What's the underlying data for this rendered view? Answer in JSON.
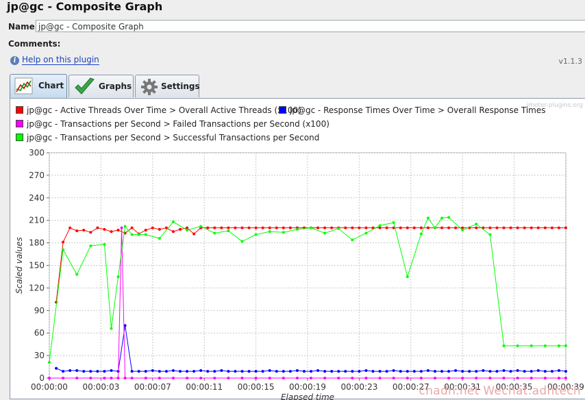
{
  "window": {
    "title": "jp@gc - Composite Graph"
  },
  "form": {
    "name_label": "Name:",
    "name_value": "jp@gc - Composite Graph",
    "comments_label": "Comments:",
    "help_link": "Help on this plugin",
    "version": "v1.1.3"
  },
  "tabs": [
    {
      "label": "Chart",
      "icon": "chart-icon",
      "active": true
    },
    {
      "label": "Graphs",
      "icon": "checkmark-icon",
      "active": false
    },
    {
      "label": "Settings",
      "icon": "gear-icon",
      "active": false
    }
  ],
  "watermark": "jmeter-plugins.org",
  "credit": "cnadn.net Wechat:adntech",
  "chart_data": {
    "type": "line",
    "xlabel": "Elapsed time",
    "ylabel": "Scaled values",
    "ylim": [
      0,
      300
    ],
    "yticks": [
      "0",
      "30",
      "60",
      "90",
      "120",
      "150",
      "180",
      "210",
      "240",
      "270",
      "300"
    ],
    "xticks": [
      {
        "t": 0,
        "label": "00:00:00"
      },
      {
        "t": 3.75,
        "label": "00:00:03"
      },
      {
        "t": 7.5,
        "label": "00:00:07"
      },
      {
        "t": 11.25,
        "label": "00:00:11"
      },
      {
        "t": 15,
        "label": "00:00:15"
      },
      {
        "t": 18.75,
        "label": "00:00:19"
      },
      {
        "t": 22.5,
        "label": "00:00:23"
      },
      {
        "t": 26.25,
        "label": "00:00:27"
      },
      {
        "t": 30,
        "label": "00:00:31"
      },
      {
        "t": 33.75,
        "label": "00:00:35"
      },
      {
        "t": 37.5,
        "label": "00:00:39"
      }
    ],
    "xmax": 37.5,
    "grid": true,
    "legend_position": "top",
    "series": [
      {
        "name": "jp@gc - Active Threads Over Time > Overall Active Threads (x100)",
        "color": "#ff0000",
        "legend_row": 0,
        "legend_col": 0,
        "x": [
          0.5,
          1,
          1.5,
          2,
          2.5,
          3,
          3.5,
          4,
          4.5,
          5,
          5.5,
          6,
          6.5,
          7,
          7.5,
          8,
          8.5,
          9,
          9.5,
          10,
          10.5,
          11,
          11.5,
          12,
          12.5,
          13,
          13.5,
          14,
          14.5,
          15,
          15.5,
          16,
          16.5,
          17,
          17.5,
          18,
          18.5,
          19,
          19.5,
          20,
          20.5,
          21,
          21.5,
          22,
          22.5,
          23,
          23.5,
          24,
          24.5,
          25,
          25.5,
          26,
          26.5,
          27,
          27.5,
          28,
          28.5,
          29,
          29.5,
          30,
          30.5,
          31,
          31.5,
          32,
          32.5,
          33,
          33.5,
          34,
          34.5,
          35,
          35.5,
          36,
          36.5,
          37,
          37.5
        ],
        "y": [
          101,
          181,
          200,
          196,
          197,
          194,
          200,
          198,
          195,
          197,
          193,
          200,
          192,
          197,
          200,
          198,
          200,
          195,
          198,
          200,
          192,
          200,
          200,
          200,
          200,
          200,
          200,
          200,
          200,
          200,
          200,
          200,
          200,
          200,
          200,
          200,
          200,
          200,
          200,
          200,
          200,
          200,
          200,
          200,
          200,
          200,
          200,
          200,
          200,
          200,
          200,
          200,
          200,
          200,
          200,
          200,
          200,
          200,
          200,
          200,
          200,
          200,
          200,
          200,
          200,
          200,
          200,
          200,
          200,
          200,
          200,
          200,
          200,
          200,
          200
        ]
      },
      {
        "name": "jp@gc - Response Times Over Time > Overall Response Times",
        "color": "#0000ff",
        "legend_row": 0,
        "legend_col": 1,
        "x": [
          0.5,
          1,
          1.5,
          2,
          2.5,
          3,
          3.5,
          4,
          4.5,
          5,
          5.5,
          6,
          6.5,
          7,
          7.5,
          8,
          8.5,
          9,
          9.5,
          10,
          10.5,
          11,
          11.5,
          12,
          12.5,
          13,
          13.5,
          14,
          14.5,
          15,
          15.5,
          16,
          16.5,
          17,
          17.5,
          18,
          18.5,
          19,
          19.5,
          20,
          20.5,
          21,
          21.5,
          22,
          22.5,
          23,
          23.5,
          24,
          24.5,
          25,
          25.5,
          26,
          26.5,
          27,
          27.5,
          28,
          28.5,
          29,
          29.5,
          30,
          30.5,
          31,
          31.5,
          32,
          32.5,
          33,
          33.5,
          34,
          34.5,
          35,
          35.5,
          36,
          36.5,
          37,
          37.5
        ],
        "y": [
          13,
          9,
          10,
          10,
          9,
          9,
          9,
          9,
          10,
          9,
          70,
          9,
          9,
          9,
          10,
          9,
          9,
          10,
          9,
          9,
          9,
          10,
          9,
          9,
          10,
          9,
          9,
          9,
          9,
          9,
          9,
          10,
          9,
          9,
          9,
          10,
          9,
          9,
          10,
          9,
          9,
          9,
          9,
          9,
          9,
          10,
          9,
          9,
          9,
          10,
          9,
          9,
          9,
          9,
          10,
          9,
          9,
          9,
          10,
          9,
          9,
          9,
          10,
          9,
          9,
          10,
          9,
          10,
          9,
          9,
          10,
          9,
          9,
          10,
          9
        ]
      },
      {
        "name": "jp@gc - Transactions per Second > Failed Transactions per Second (x100)",
        "color": "#ff00ff",
        "legend_row": 1,
        "legend_col": 0,
        "x": [
          0,
          1,
          2,
          3,
          4,
          4.5,
          5,
          5.25,
          5.5,
          6,
          7,
          8,
          9,
          10,
          11,
          12,
          13,
          14,
          15,
          16,
          17,
          18,
          19,
          20,
          21,
          22,
          23,
          24,
          25,
          26,
          27,
          28,
          29,
          30,
          31,
          32,
          33,
          34,
          35,
          36,
          37,
          37.5
        ],
        "y": [
          0,
          0,
          0,
          0,
          0,
          0,
          0,
          200,
          0,
          0,
          0,
          0,
          0,
          0,
          0,
          0,
          0,
          0,
          0,
          0,
          0,
          0,
          0,
          0,
          0,
          0,
          0,
          0,
          0,
          0,
          0,
          0,
          0,
          0,
          0,
          0,
          0,
          0,
          0,
          0,
          0,
          0
        ]
      },
      {
        "name": "jp@gc - Transactions per Second > Successful Transactions per Second",
        "color": "#00ff00",
        "legend_row": 2,
        "legend_col": 0,
        "x": [
          0,
          1,
          2,
          3,
          4,
          4.5,
          5,
          5.5,
          6,
          6.5,
          7,
          8,
          9,
          10,
          11,
          12,
          13,
          14,
          15,
          16,
          17,
          18,
          19,
          20,
          21,
          22,
          23,
          24,
          25,
          26,
          27,
          27.5,
          28,
          28.5,
          29,
          30,
          31,
          32,
          33,
          34,
          35,
          36,
          37,
          37.5
        ],
        "y": [
          21,
          171,
          138,
          176,
          178,
          66,
          135,
          202,
          191,
          191,
          191,
          186,
          208,
          197,
          202,
          193,
          196,
          182,
          191,
          195,
          194,
          198,
          200,
          193,
          199,
          184,
          193,
          203,
          207,
          135,
          192,
          213,
          200,
          213,
          214,
          197,
          205,
          191,
          43,
          43,
          43,
          43,
          43,
          43
        ]
      }
    ]
  }
}
